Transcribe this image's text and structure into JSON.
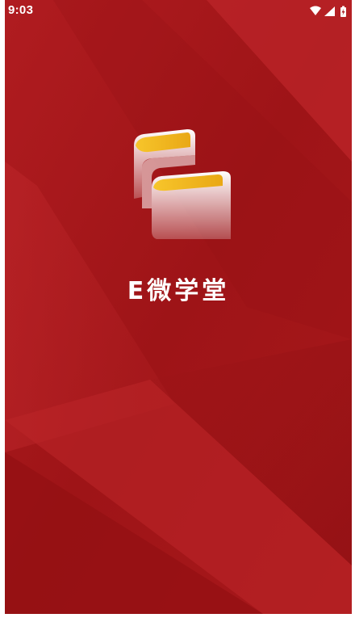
{
  "status_bar": {
    "time": "9:03",
    "icons": [
      "wifi-icon",
      "cellular-signal-icon",
      "battery-charging-icon"
    ]
  },
  "splash": {
    "app_name": "E微学堂",
    "logo_icon": "stacked-books-logo-icon",
    "colors": {
      "background": "#a51619",
      "stripe_light": "#c12a2e",
      "stripe_dark": "#8f0f12",
      "logo_gold": "#f2b91c",
      "logo_white": "#ffffff",
      "status_bar": "#ffffff"
    }
  }
}
